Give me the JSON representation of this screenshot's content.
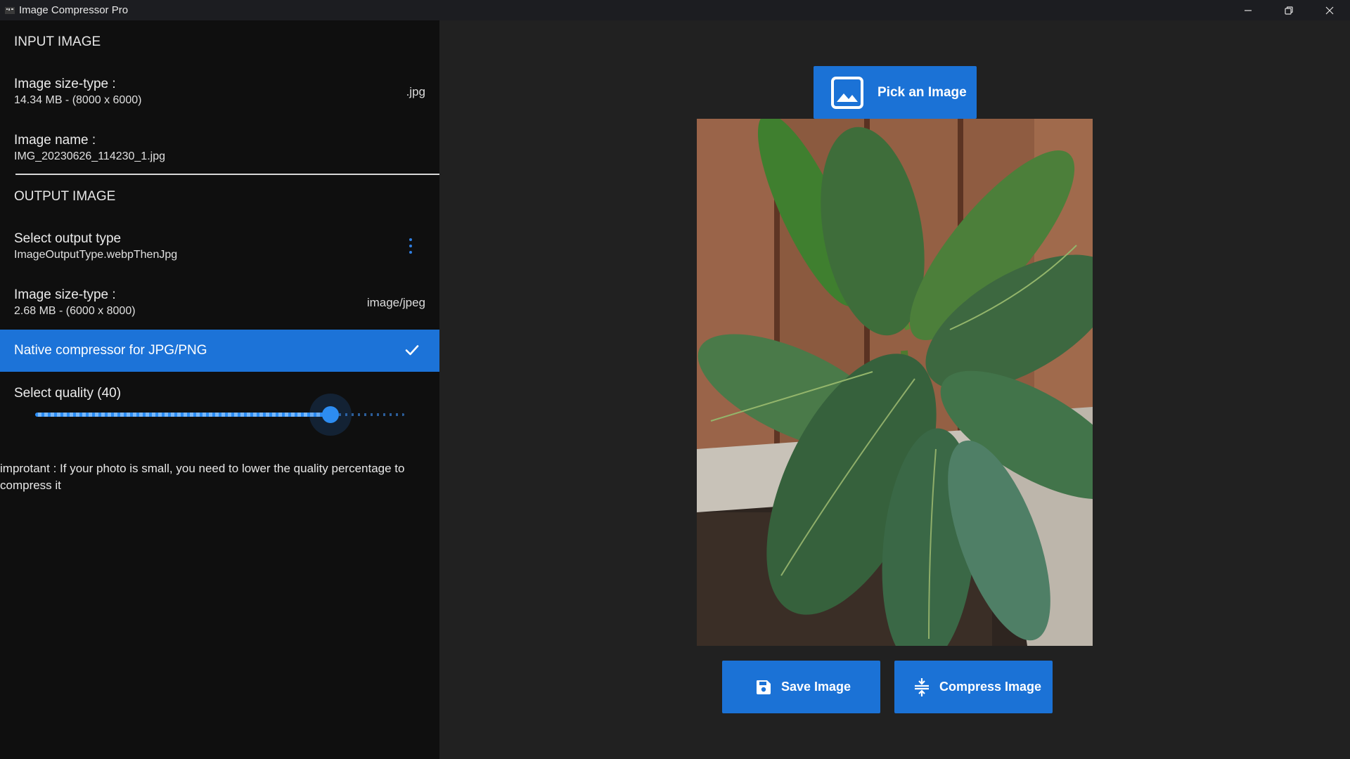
{
  "window": {
    "title": "Image Compressor Pro",
    "controls": [
      "minimize",
      "restore",
      "close"
    ]
  },
  "input_section": {
    "header": "INPUT IMAGE",
    "size_type": {
      "title": "Image size-type :",
      "value": "14.34 MB - (8000 x 6000)",
      "extension": ".jpg"
    },
    "name": {
      "title": "Image name :",
      "value": "IMG_20230626_114230_1.jpg"
    }
  },
  "output_section": {
    "header": "OUTPUT IMAGE",
    "output_type": {
      "title": "Select output type",
      "value": "ImageOutputType.webpThenJpg"
    },
    "size_type": {
      "title": "Image size-type :",
      "value": "2.68 MB - (6000 x 8000)",
      "mime": "image/jpeg"
    },
    "native_compressor": {
      "label": "Native compressor for JPG/PNG",
      "checked": true
    },
    "quality": {
      "label": "Select quality (40)",
      "value": 40,
      "slider_fraction": 0.8
    },
    "note": "improtant : If your photo is small, you need to lower the quality percentage to compress it"
  },
  "actions": {
    "pick_label": "Pick an Image",
    "save_label": "Save Image",
    "compress_label": "Compress Image"
  },
  "preview": {
    "subject": "potted rubber plant in front of a wooden fence"
  },
  "colors": {
    "accent": "#1b72d6",
    "left_panel_bg": "#0f0f0f",
    "right_panel_bg": "#212121"
  }
}
